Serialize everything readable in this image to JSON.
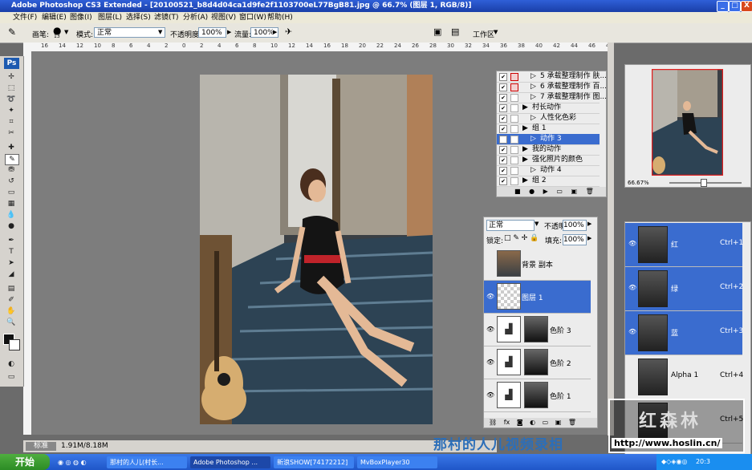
{
  "window": {
    "title": "Adobe Photoshop CS3 Extended - [20100521_b8d4d04ca1d9fe2f1103700eL77BgB81.jpg @ 66.7% (图层 1, RGB/8)]",
    "min": "_",
    "max": "□",
    "close": "X"
  },
  "menu": [
    "文件(F)",
    "编辑(E)",
    "图像(I)",
    "图层(L)",
    "选择(S)",
    "滤镜(T)",
    "分析(A)",
    "视图(V)",
    "窗口(W)",
    "帮助(H)"
  ],
  "options": {
    "brush_label": "画笔:",
    "brush_size": "13",
    "mode_label": "模式:",
    "mode_value": "正常",
    "opacity_label": "不透明度:",
    "opacity_value": "100%",
    "flow_label": "流量:",
    "flow_value": "100%",
    "workspace_label": "工作区"
  },
  "toolbox": {
    "ps": "Ps"
  },
  "ruler_ticks": [
    "16",
    "14",
    "12",
    "10",
    "8",
    "6",
    "4",
    "2",
    "0",
    "2",
    "4",
    "6",
    "8",
    "10",
    "12",
    "14",
    "16",
    "18",
    "20",
    "22",
    "24",
    "26",
    "28",
    "30",
    "32",
    "34",
    "36",
    "38",
    "40",
    "42",
    "44",
    "46",
    "48"
  ],
  "actions": {
    "rows": [
      {
        "label": "5 承载整理制作 肤...",
        "checked": true,
        "red": true,
        "selected": false,
        "indent": 1
      },
      {
        "label": "6 承载整理制作 百...",
        "checked": true,
        "red": true,
        "selected": false,
        "indent": 1
      },
      {
        "label": "7 承载整理制作 图...",
        "checked": true,
        "red": false,
        "selected": false,
        "indent": 1
      },
      {
        "label": "村长动作",
        "checked": true,
        "red": false,
        "selected": false,
        "indent": 0
      },
      {
        "label": "人性化色彩",
        "checked": true,
        "red": false,
        "selected": false,
        "indent": 1
      },
      {
        "label": "组 1",
        "checked": true,
        "red": false,
        "selected": false,
        "indent": 0
      },
      {
        "label": "动作 3",
        "checked": true,
        "red": false,
        "selected": true,
        "indent": 1
      },
      {
        "label": "我的动作",
        "checked": true,
        "red": false,
        "selected": false,
        "indent": 0
      },
      {
        "label": "强化照片的颜色",
        "checked": true,
        "red": false,
        "selected": false,
        "indent": 0
      },
      {
        "label": "动作 4",
        "checked": true,
        "red": false,
        "selected": false,
        "indent": 1
      },
      {
        "label": "组 2",
        "checked": true,
        "red": false,
        "selected": false,
        "indent": 0
      }
    ]
  },
  "layers": {
    "blend_mode": "正常",
    "opacity_label": "不透明度:",
    "opacity_value": "100%",
    "lock_label": "锁定:",
    "fill_label": "填充:",
    "fill_value": "100%",
    "rows": [
      {
        "name": "背景 副本",
        "selected": false,
        "visible": false,
        "type": "photo"
      },
      {
        "name": "图层 1",
        "selected": true,
        "visible": true,
        "type": "transparent"
      },
      {
        "name": "色阶 3",
        "selected": false,
        "visible": true,
        "type": "adjust"
      },
      {
        "name": "色阶 2",
        "selected": false,
        "visible": true,
        "type": "adjust"
      },
      {
        "name": "色阶 1",
        "selected": false,
        "visible": true,
        "type": "adjust"
      }
    ]
  },
  "navigator": {
    "zoom": "66.67%"
  },
  "channels": {
    "rows": [
      {
        "name": "红",
        "shortcut": "Ctrl+1",
        "selected": true
      },
      {
        "name": "绿",
        "shortcut": "Ctrl+2",
        "selected": true
      },
      {
        "name": "蓝",
        "shortcut": "Ctrl+3",
        "selected": true
      },
      {
        "name": "Alpha 1",
        "shortcut": "Ctrl+4",
        "selected": false
      },
      {
        "name": "",
        "shortcut": "Ctrl+5",
        "selected": false
      }
    ]
  },
  "status": {
    "doc": "1.91M/8.18M",
    "mode": "标准"
  },
  "watermark": "那村的人儿视频录相",
  "logo": {
    "name": "红森林",
    "url": "http://www.hoslin.cn/"
  },
  "taskbar": {
    "start": "开始",
    "tasks": [
      "那村的人儿(村长...",
      "Adobe Photoshop ...",
      "新浪SHOW[74172212]",
      "MvBoxPlayer30"
    ],
    "clock": "20:3"
  },
  "colors": {
    "selection": "#3a6ccf",
    "title": "#1a3fa8",
    "watermark": "#2c6eb8"
  }
}
